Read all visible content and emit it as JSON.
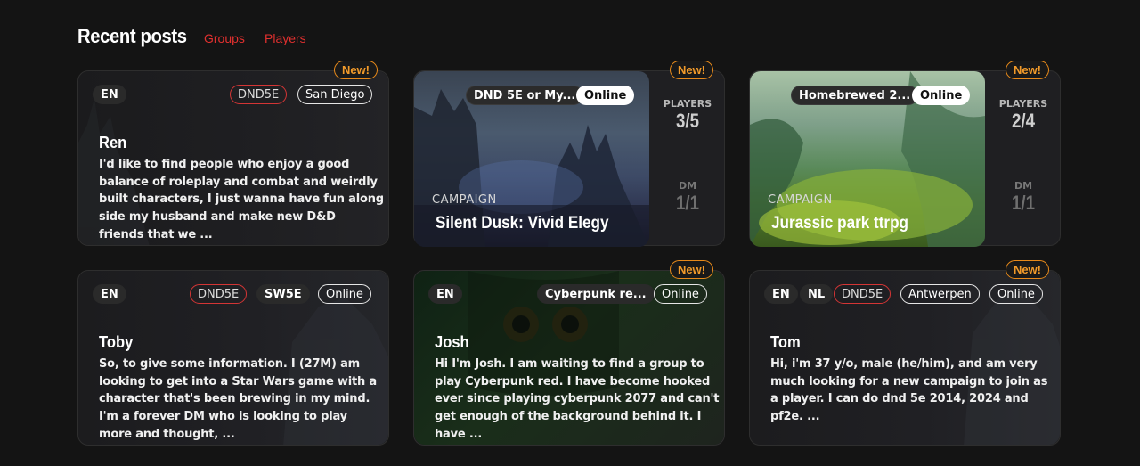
{
  "header": {
    "title": "Recent posts",
    "tabs": [
      "Groups",
      "Players"
    ]
  },
  "colors": {
    "accent_red": "#e0302f",
    "new_badge": "#f19a2a",
    "background": "#141414"
  },
  "cards": [
    {
      "badge": "New!",
      "language": "EN",
      "system": "DND5E",
      "location": "San Diego",
      "name": "Ren",
      "description": "I'd like to find people who enjoy a good balance of roleplay and combat and weirdly built characters, I just wanna have fun along side my husband and make new D&D friends that we ..."
    },
    {
      "badge": "New!",
      "system": "DND 5E or My...",
      "mode": "Online",
      "label": "CAMPAIGN",
      "title": "Silent Dusk: Vivid Elegy",
      "players_label": "PLAYERS",
      "players": "3/5",
      "dm_label": "DM",
      "dm": "1/1"
    },
    {
      "badge": "New!",
      "system": "Homebrewed 2...",
      "mode": "Online",
      "label": "CAMPAIGN",
      "title": "Jurassic park ttrpg",
      "players_label": "PLAYERS",
      "players": "2/4",
      "dm_label": "DM",
      "dm": "1/1"
    },
    {
      "language": "EN",
      "system": "DND5E",
      "system2": "SW5E",
      "mode": "Online",
      "name": "Toby",
      "description": "So, to give some information. I (27M) am looking to get into a Star Wars game with a character that's been brewing in my mind. I'm a forever DM who is looking to play more and thought, ..."
    },
    {
      "badge": "New!",
      "language": "EN",
      "system": "Cyberpunk re...",
      "mode": "Online",
      "name": "Josh",
      "description": "Hi I'm Josh. I am waiting to find a group to play Cyberpunk red. I have become hooked ever since playing cyberpunk 2077 and can't get enough of the background behind it. I have ..."
    },
    {
      "badge": "New!",
      "language": "EN",
      "language2": "NL",
      "system": "DND5E",
      "location": "Antwerpen",
      "mode": "Online",
      "name": "Tom",
      "description": "Hi, i'm 37 y/o, male (he/him), and am very much looking for a new campaign to join as a player. I can do dnd 5e 2014, 2024 and pf2e. ..."
    }
  ]
}
